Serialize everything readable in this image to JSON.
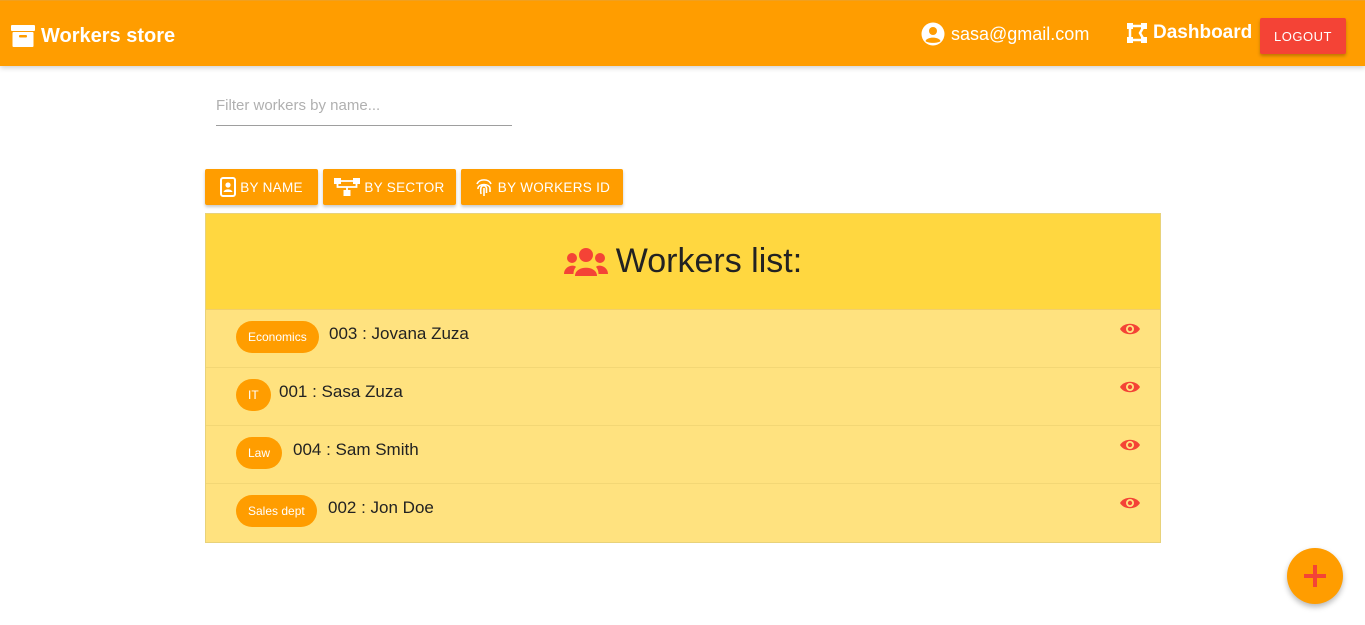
{
  "navbar": {
    "brand": "Workers store",
    "user_email": "sasa@gmail.com",
    "dashboard_label": "Dashboard",
    "logout_label": "LOGOUT"
  },
  "filter": {
    "placeholder": "Filter workers by name...",
    "value": ""
  },
  "sort_buttons": {
    "by_name": "BY NAME",
    "by_sector": "BY SECTOR",
    "by_workers_id": "BY WORKERS ID"
  },
  "list": {
    "title": "Workers list:",
    "workers": [
      {
        "sector": "Economics",
        "label": "003 : Jovana Zuza"
      },
      {
        "sector": "IT",
        "label": "001 : Sasa Zuza"
      },
      {
        "sector": "Law",
        "label": "004 : Sam Smith"
      },
      {
        "sector": "Sales dept",
        "label": "002 : Jon Doe"
      }
    ]
  },
  "colors": {
    "primary": "#ff9d00",
    "accent": "#f44336",
    "list_header": "#ffd740",
    "list_body": "#ffe27f"
  },
  "icons": {
    "brand": "archive-box-icon",
    "user": "account-circle-icon",
    "dashboard": "dashboard-icon",
    "by_name": "badge-icon",
    "by_sector": "sitemap-icon",
    "by_id": "fingerprint-icon",
    "list": "users-icon",
    "view": "eye-icon",
    "add": "plus-icon"
  }
}
